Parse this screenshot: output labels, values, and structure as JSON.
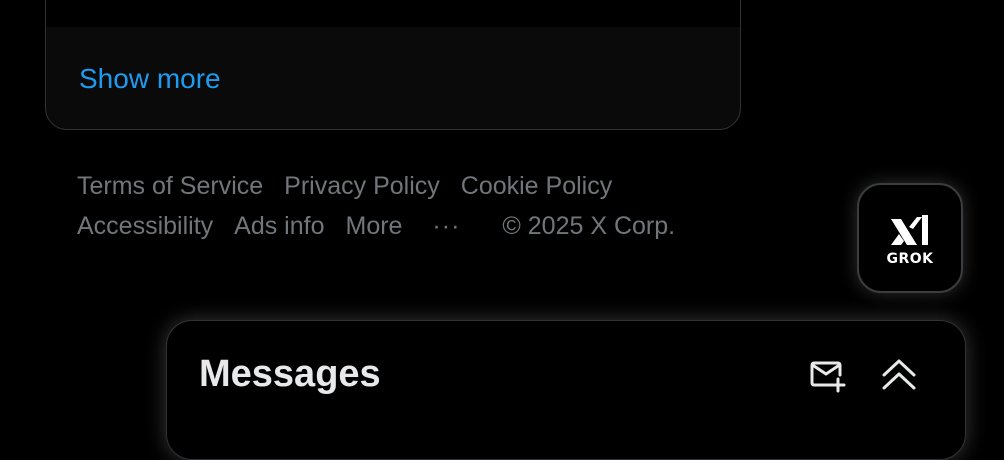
{
  "trends_panel": {
    "show_more_label": "Show more"
  },
  "footer": {
    "links": [
      "Terms of Service",
      "Privacy Policy",
      "Cookie Policy",
      "Accessibility",
      "Ads info"
    ],
    "more_label": "More",
    "more_icon": "···",
    "copyright": "© 2025 X Corp."
  },
  "grok_button": {
    "label": "GROK",
    "icon": "grok-logo-icon"
  },
  "messages_drawer": {
    "title": "Messages",
    "compose_icon": "new-message-icon",
    "expand_icon": "chevrons-up-icon"
  },
  "colors": {
    "background": "#000000",
    "link_blue": "#1d9bf0",
    "footer_gray": "#71767b",
    "text": "#e7e9ea"
  }
}
